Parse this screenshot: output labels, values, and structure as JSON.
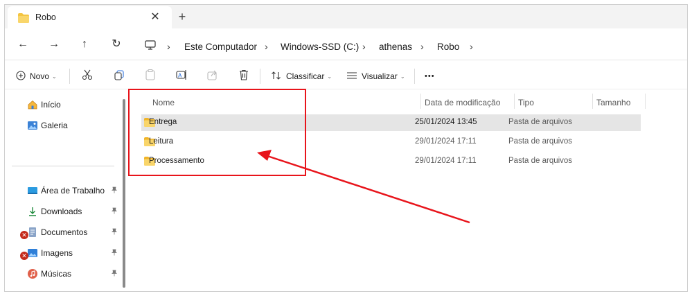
{
  "window": {
    "tab": {
      "title": "Robo",
      "close_glyph": "✕",
      "new_tab_glyph": "+"
    }
  },
  "nav": {
    "back_glyph": "←",
    "forward_glyph": "→",
    "up_glyph": "↑",
    "refresh_glyph": "↻",
    "breadcrumb": [
      "Este Computador",
      "Windows-SSD (C:)",
      "athenas",
      "Robo"
    ],
    "sep_glyph": "›"
  },
  "commands": {
    "new_label": "Novo",
    "sort_label": "Classificar",
    "view_label": "Visualizar",
    "more_glyph": "•••",
    "caret_glyph": "⌄"
  },
  "sidebar": {
    "top_items": [
      {
        "label": "Início",
        "icon": "home-icon"
      },
      {
        "label": "Galeria",
        "icon": "gallery-icon"
      }
    ],
    "pinned_items": [
      {
        "label": "Área de Trabalho",
        "icon": "desktop-icon",
        "error": false
      },
      {
        "label": "Downloads",
        "icon": "download-icon",
        "error": false
      },
      {
        "label": "Documentos",
        "icon": "documents-icon",
        "error": true
      },
      {
        "label": "Imagens",
        "icon": "pictures-icon",
        "error": true
      },
      {
        "label": "Músicas",
        "icon": "music-icon",
        "error": false
      }
    ],
    "pin_glyph": "📌"
  },
  "files": {
    "columns": {
      "name": "Nome",
      "modified": "Data de modificação",
      "type": "Tipo",
      "size": "Tamanho"
    },
    "rows": [
      {
        "name": "Entrega",
        "modified": "25/01/2024 13:45",
        "type": "Pasta de arquivos",
        "size": "",
        "selected": true
      },
      {
        "name": "Leitura",
        "modified": "29/01/2024 17:11",
        "type": "Pasta de arquivos",
        "size": "",
        "selected": false
      },
      {
        "name": "Processamento",
        "modified": "29/01/2024 17:11",
        "type": "Pasta de arquivos",
        "size": "",
        "selected": false
      }
    ]
  },
  "colors": {
    "accent_red": "#e8141b",
    "folder_yellow": "#f4c542",
    "selected_row": "#e5e5e5"
  }
}
